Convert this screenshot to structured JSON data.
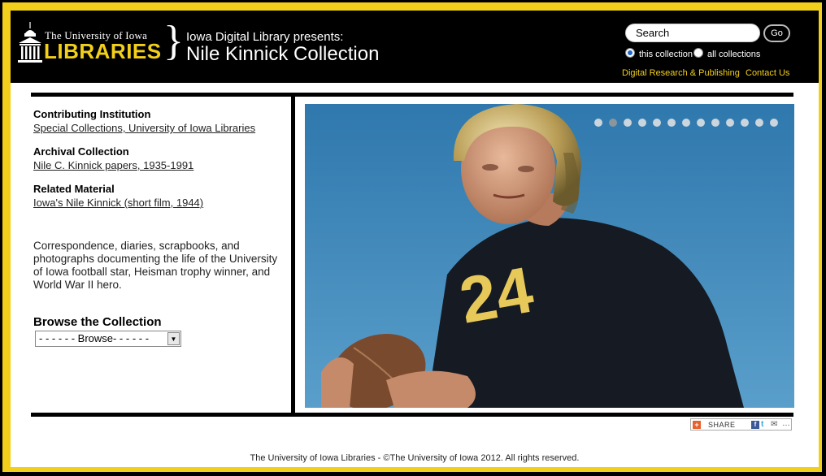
{
  "header": {
    "logo_university": "The University of Iowa",
    "logo_libraries": "LIBRARIES",
    "presents": "Iowa Digital Library presents:",
    "collection_title": "Nile Kinnick Collection"
  },
  "search": {
    "placeholder": "Search",
    "go_label": "Go",
    "radio_this": "this collection",
    "radio_all": "all collections",
    "selected": "this collection"
  },
  "header_links": {
    "digital_research": "Digital Research & Publishing",
    "contact": "Contact Us"
  },
  "sidebar": {
    "contributing_label": "Contributing Institution",
    "contributing_link": "Special Collections, University of Iowa Libraries",
    "archival_label": "Archival Collection",
    "archival_link": "Nile C. Kinnick papers, 1935-1991",
    "related_label": "Related Material",
    "related_link": "Iowa's Nile Kinnick (short film, 1944)",
    "description": "Correspondence, diaries, scrapbooks, and photographs documenting the life of the University of Iowa football star, Heisman trophy winner, and World War II hero.",
    "browse_heading": "Browse the Collection",
    "browse_value": "- - - - - - Browse- - - - - -"
  },
  "slideshow": {
    "dot_count": 13,
    "active_index": 1,
    "jersey_number": "24"
  },
  "share": {
    "label": "SHARE"
  },
  "footer": {
    "text": "The University of Iowa Libraries - ©The University of Iowa 2012. All rights reserved."
  },
  "colors": {
    "brand_gold": "#f2cf1a",
    "header_bg": "#000000",
    "sky_blue": "#3f86b8"
  }
}
